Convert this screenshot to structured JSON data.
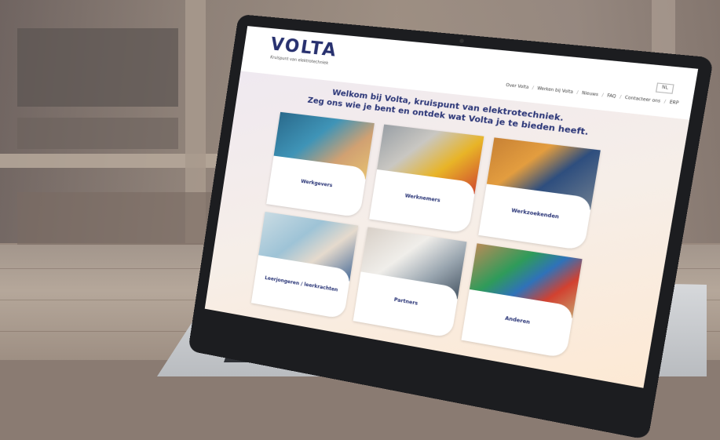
{
  "site": {
    "logo": "VOLTA",
    "tagline": "Kruispunt van elektrotechniek",
    "language": "NL",
    "nav": [
      "Over Volta",
      "Werken bij Volta",
      "Nieuws",
      "FAQ",
      "Contacteer ons",
      "ERP"
    ],
    "welcome_line1": "Welkom bij Volta, kruispunt van elektrotechniek.",
    "welcome_line2": "Zeg ons wie je bent en ontdek wat Volta je te bieden heeft."
  },
  "cards": [
    {
      "label": "Werkgevers",
      "image": "workers-on-site-photo"
    },
    {
      "label": "Werknemers",
      "image": "worker-with-helmet-photo"
    },
    {
      "label": "Werkzoekenden",
      "image": "two-men-talking-photo"
    },
    {
      "label": "Leerjongeren / leerkrachten",
      "image": "student-at-whiteboard-photo"
    },
    {
      "label": "Partners",
      "image": "puzzle-hands-photo"
    },
    {
      "label": "Anderen",
      "image": "colored-cables-photo"
    }
  ],
  "colors": {
    "brand": "#28316f",
    "heading": "#2a3577"
  }
}
